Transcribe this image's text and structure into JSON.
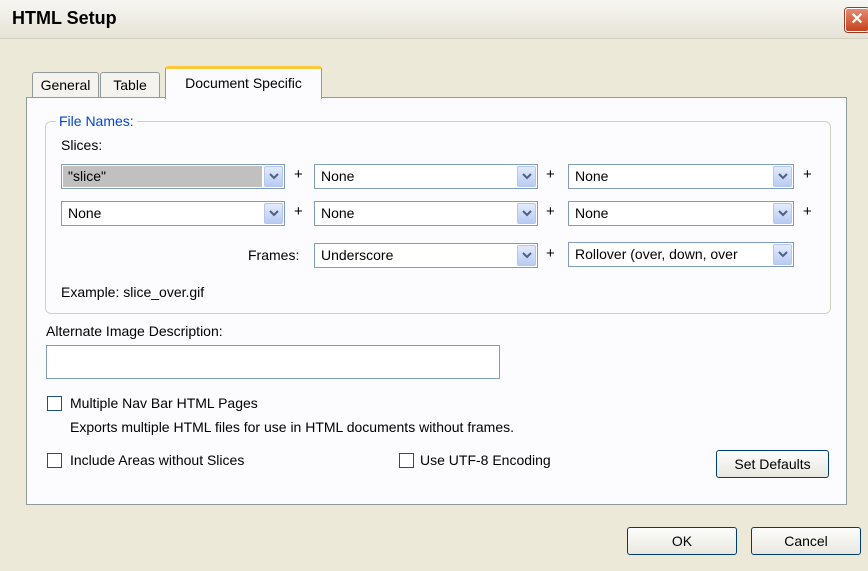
{
  "window": {
    "title": "HTML Setup",
    "close_icon": "close-icon"
  },
  "tabs": [
    {
      "label": "General"
    },
    {
      "label": "Table"
    },
    {
      "label": "Document Specific",
      "active": true
    }
  ],
  "file_names": {
    "legend": "File Names:",
    "slices_label": "Slices:",
    "row1": [
      "\"slice\"",
      "None",
      "None"
    ],
    "row2": [
      "None",
      "None",
      "None"
    ],
    "plus": "+",
    "frames_label": "Frames:",
    "frames_values": [
      "Underscore",
      "Rollover (over, down, over"
    ],
    "example": "Example: slice_over.gif"
  },
  "alt_description": {
    "label": "Alternate Image Description:",
    "value": ""
  },
  "options": {
    "multi_nav": {
      "label": "Multiple Nav Bar HTML Pages",
      "checked": false,
      "desc": "Exports multiple HTML files for use in HTML documents without frames."
    },
    "include_areas": {
      "label": "Include Areas without Slices",
      "checked": false
    },
    "utf8": {
      "label": "Use UTF-8 Encoding",
      "checked": false
    }
  },
  "buttons": {
    "set_defaults": "Set Defaults",
    "ok": "OK",
    "cancel": "Cancel"
  },
  "colors": {
    "legend": "#0046d5",
    "active_tab_accent": "#ffc83c",
    "selected_combo": "#c0c0c0"
  }
}
